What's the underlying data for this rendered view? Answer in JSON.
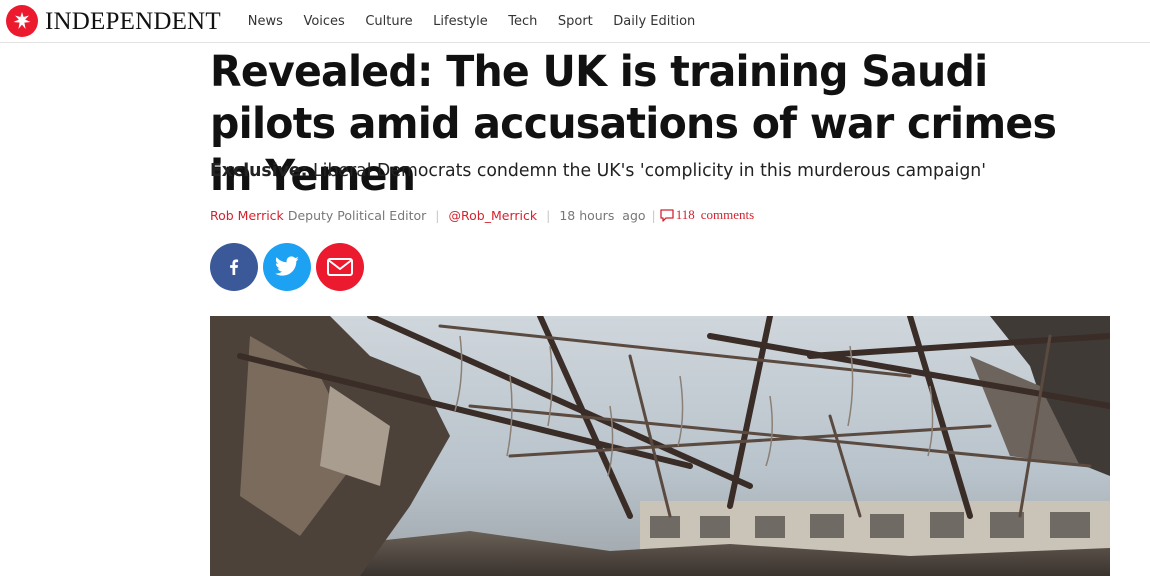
{
  "header": {
    "brand": "INDEPENDENT",
    "nav": [
      "News",
      "Voices",
      "Culture",
      "Lifestyle",
      "Tech",
      "Sport",
      "Daily Edition"
    ]
  },
  "article": {
    "headline": "Revealed: The UK is training Saudi pilots amid accusations of war crimes in Yemen",
    "standfirst_kicker": "Exclusive:",
    "standfirst": "Liberal Democrats condemn the UK's 'complicity in this murderous campaign'",
    "author": "Rob Merrick",
    "author_role": "Deputy Political Editor",
    "twitter_handle": "@Rob_Merrick",
    "time_ago": "18 hours  ago",
    "comment_count": "118",
    "comments_label": "comments"
  },
  "share": {
    "facebook": "facebook-icon",
    "twitter": "twitter-icon",
    "email": "mail-icon"
  },
  "colors": {
    "brand_red": "#ec1a2e",
    "link_red": "#d4232e",
    "facebook": "#3b5998",
    "twitter": "#1da1f2",
    "email": "#ec1a2e"
  }
}
